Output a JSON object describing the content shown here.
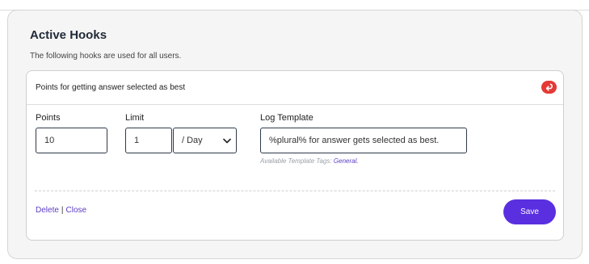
{
  "section": {
    "title": "Active Hooks",
    "subtitle": "The following hooks are used for all users."
  },
  "hook": {
    "title": "Points for getting answer selected as best",
    "collapse_icon": "return-arrow-icon",
    "fields": {
      "points": {
        "label": "Points",
        "value": "10"
      },
      "limit": {
        "label": "Limit",
        "value": "1",
        "period": "/ Day"
      },
      "log_template": {
        "label": "Log Template",
        "value": "%plural% for answer gets selected as best."
      }
    },
    "hint_prefix": "Available Template Tags:",
    "hint_link": "General.",
    "delete_label": "Delete",
    "separator": "|",
    "close_label": "Close",
    "save_label": "Save"
  },
  "colors": {
    "accent": "#5a2fe0",
    "link": "#5b3cc4",
    "badge": "#e53935"
  }
}
